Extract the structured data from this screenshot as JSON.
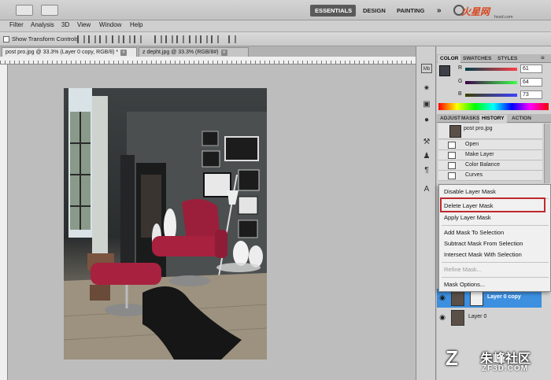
{
  "workspace": {
    "essentials": "ESSENTIALS",
    "design": "DESIGN",
    "painting": "PAINTING",
    "more": "»"
  },
  "menu": [
    "Filter",
    "Analysis",
    "3D",
    "View",
    "Window",
    "Help"
  ],
  "options_bar": {
    "show_transform_controls": "Show Transform Controls"
  },
  "documents": {
    "tab1": "post pro.jpg @ 33.3% (Layer 0 copy, RGB/8) *",
    "tab2": "z depht.jpg @ 33.3% (RGB/8#)",
    "close_glyph": "×"
  },
  "color_panel": {
    "tabs": [
      "COLOR",
      "SWATCHES",
      "STYLES"
    ],
    "r_label": "R",
    "r_value": "61",
    "g_label": "G",
    "g_value": "64",
    "b_label": "B",
    "b_value": "73"
  },
  "history_panel": {
    "tabs": [
      "ADJUST",
      "MASKS",
      "HISTORY",
      "ACTION"
    ],
    "snapshot": "post pro.jpg",
    "items": [
      "Open",
      "Make Layer",
      "Color Balance",
      "Curves"
    ]
  },
  "context_menu": {
    "items": [
      "Disable Layer Mask",
      "Delete Layer Mask",
      "Apply Layer Mask",
      "Add Mask To Selection",
      "Subtract Mask From Selection",
      "Intersect Mask With Selection",
      "Refine Mask...",
      "Mask Options..."
    ]
  },
  "layers": {
    "rows": [
      "Layer 0 copy",
      "Layer 0"
    ]
  },
  "watermark": {
    "top": "火星网",
    "top_sub": "hxsd.com",
    "bottom": "朱峰社区",
    "bottom_sub": "ZF3D.COM",
    "logo": "Z"
  },
  "colors": {
    "accent_active": "#5a5a5a",
    "highlight_border": "#c0282c",
    "layer_selected": "#3d8fe0"
  }
}
